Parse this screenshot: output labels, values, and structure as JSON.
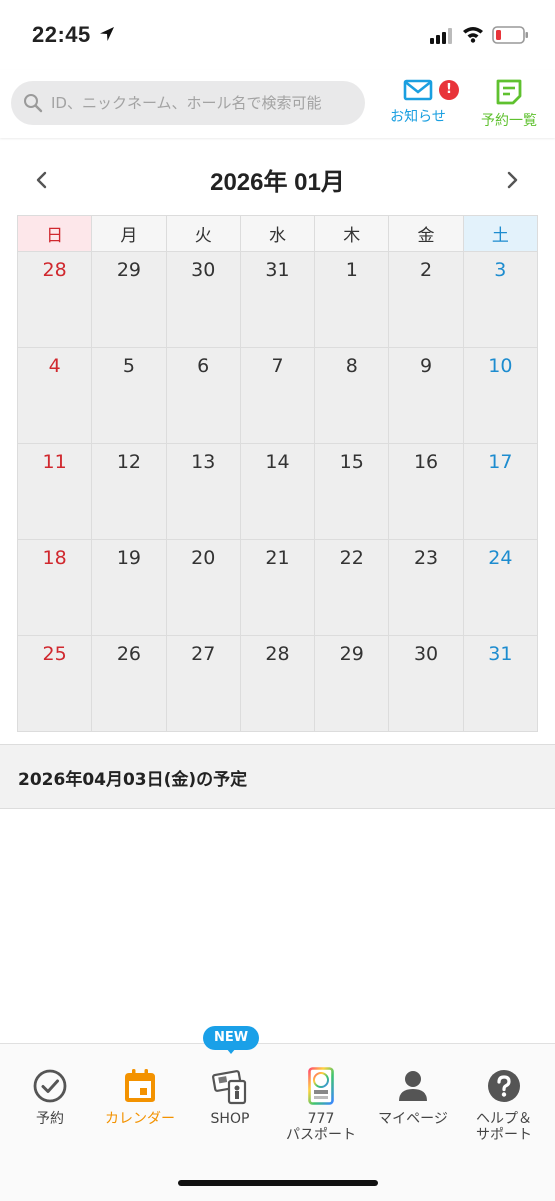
{
  "status": {
    "time": "22:45"
  },
  "search": {
    "placeholder": "ID、ニックネーム、ホール名で検索可能"
  },
  "header": {
    "notice_label": "お知らせ",
    "notice_badge": "!",
    "reservations_label": "予約一覧",
    "colors": {
      "notice": "#1a9fe0",
      "reservations": "#5fc12f",
      "badge": "#e8343a"
    }
  },
  "calendar": {
    "title": "2026年 01月",
    "weekdays": [
      "日",
      "月",
      "火",
      "水",
      "木",
      "金",
      "土"
    ],
    "weeks": [
      [
        "28",
        "29",
        "30",
        "31",
        "1",
        "2",
        "3"
      ],
      [
        "4",
        "5",
        "6",
        "7",
        "8",
        "9",
        "10"
      ],
      [
        "11",
        "12",
        "13",
        "14",
        "15",
        "16",
        "17"
      ],
      [
        "18",
        "19",
        "20",
        "21",
        "22",
        "23",
        "24"
      ],
      [
        "25",
        "26",
        "27",
        "28",
        "29",
        "30",
        "31"
      ]
    ],
    "colors": {
      "sunday": "#d0282e",
      "saturday": "#1d8ccf"
    }
  },
  "schedule": {
    "heading": "2026年04月03日(金)の予定"
  },
  "tabbar": {
    "new_badge": "NEW",
    "active_color": "#f39200",
    "tabs": [
      {
        "label": "予約",
        "icon": "check-circle-icon"
      },
      {
        "label": "カレンダー",
        "icon": "calendar-icon"
      },
      {
        "label": "SHOP",
        "icon": "shop-tickets-icon"
      },
      {
        "label_line1": "777",
        "label_line2": "パスポート",
        "icon": "passport-icon"
      },
      {
        "label": "マイページ",
        "icon": "person-icon"
      },
      {
        "label_line1": "ヘルプ＆",
        "label_line2": "サポート",
        "icon": "help-icon"
      }
    ]
  }
}
